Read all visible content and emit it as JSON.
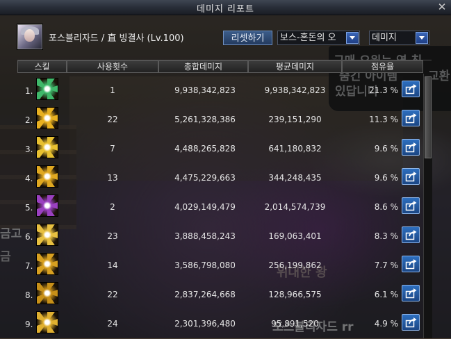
{
  "window": {
    "title": "데미지 리포트",
    "close_symbol": "✕"
  },
  "character": {
    "name": "포스블리자드 / 直 빙결사 (Lv.100)"
  },
  "controls": {
    "reset_label": "리셋하기",
    "target_dropdown": "보스-혼돈의 오",
    "metric_dropdown": "데미지"
  },
  "table": {
    "headers": {
      "skill": "스킬",
      "uses": "사용횟수",
      "total": "총합데미지",
      "avg": "평균데미지",
      "share": "점유율"
    },
    "rows": [
      {
        "index": "1.",
        "uses": "1",
        "total": "9,938,342,823",
        "avg": "9,938,342,823",
        "share": "21.3 %",
        "icon": "green-frost-burst-icon",
        "color": "#3fb86a"
      },
      {
        "index": "2.",
        "uses": "22",
        "total": "5,261,328,386",
        "avg": "239,151,290",
        "share": "11.3 %",
        "icon": "golden-flame-spikes-icon",
        "color": "#e8b020"
      },
      {
        "index": "3.",
        "uses": "7",
        "total": "4,488,265,828",
        "avg": "641,180,832",
        "share": "9.6 %",
        "icon": "golden-starburst-icon",
        "color": "#e8c030"
      },
      {
        "index": "4.",
        "uses": "13",
        "total": "4,475,229,663",
        "avg": "344,248,435",
        "share": "9.6 %",
        "icon": "golden-wing-strike-icon",
        "color": "#e0a820"
      },
      {
        "index": "5.",
        "uses": "2",
        "total": "4,029,149,479",
        "avg": "2,014,574,739",
        "share": "8.6 %",
        "icon": "purple-crystal-field-icon",
        "color": "#9a40c0"
      },
      {
        "index": "6.",
        "uses": "23",
        "total": "3,888,458,243",
        "avg": "169,063,401",
        "share": "8.3 %",
        "icon": "golden-star-icon",
        "color": "#e8c040"
      },
      {
        "index": "7.",
        "uses": "14",
        "total": "3,586,798,080",
        "avg": "256,199,862",
        "share": "7.7 %",
        "icon": "golden-ring-burst-icon",
        "color": "#d8a020"
      },
      {
        "index": "8.",
        "uses": "22",
        "total": "2,837,264,668",
        "avg": "128,966,575",
        "share": "6.1 %",
        "icon": "golden-bow-icon",
        "color": "#c89018"
      },
      {
        "index": "9.",
        "uses": "24",
        "total": "2,301,396,480",
        "avg": "95,891,520",
        "share": "4.9 %",
        "icon": "golden-arrow-burst-icon",
        "color": "#e0b030"
      }
    ]
  },
  "background": {
    "bubble_lines": [
      "구매 요원는 역 칭",
      "숨긴 아이템",
      "있답니다",
      "교환"
    ],
    "left_text_1": "금고",
    "left_text_2": "금",
    "center_caption": "위대한 왕",
    "nameplate": "포스블리자드 rr"
  }
}
